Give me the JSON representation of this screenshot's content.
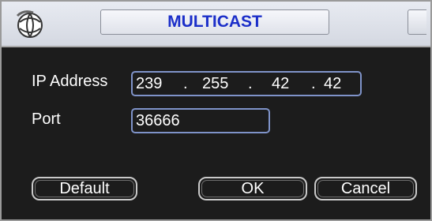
{
  "window": {
    "title": "MULTICAST"
  },
  "form": {
    "ip_label": "IP Address",
    "ip": {
      "octet1": "239",
      "dot1": ".",
      "octet2": "255",
      "dot2": ".",
      "octet3": "42",
      "dot3": ".",
      "octet4": "42"
    },
    "port_label": "Port",
    "port_value": "36666"
  },
  "buttons": {
    "default_label": "Default",
    "ok_label": "OK",
    "cancel_label": "Cancel"
  },
  "icons": {
    "logo": "globe-logo-icon",
    "close": "close-icon"
  },
  "colors": {
    "title_text": "#1b2ec9",
    "background": "#1c1c1c",
    "field_border": "#7f93c9"
  }
}
